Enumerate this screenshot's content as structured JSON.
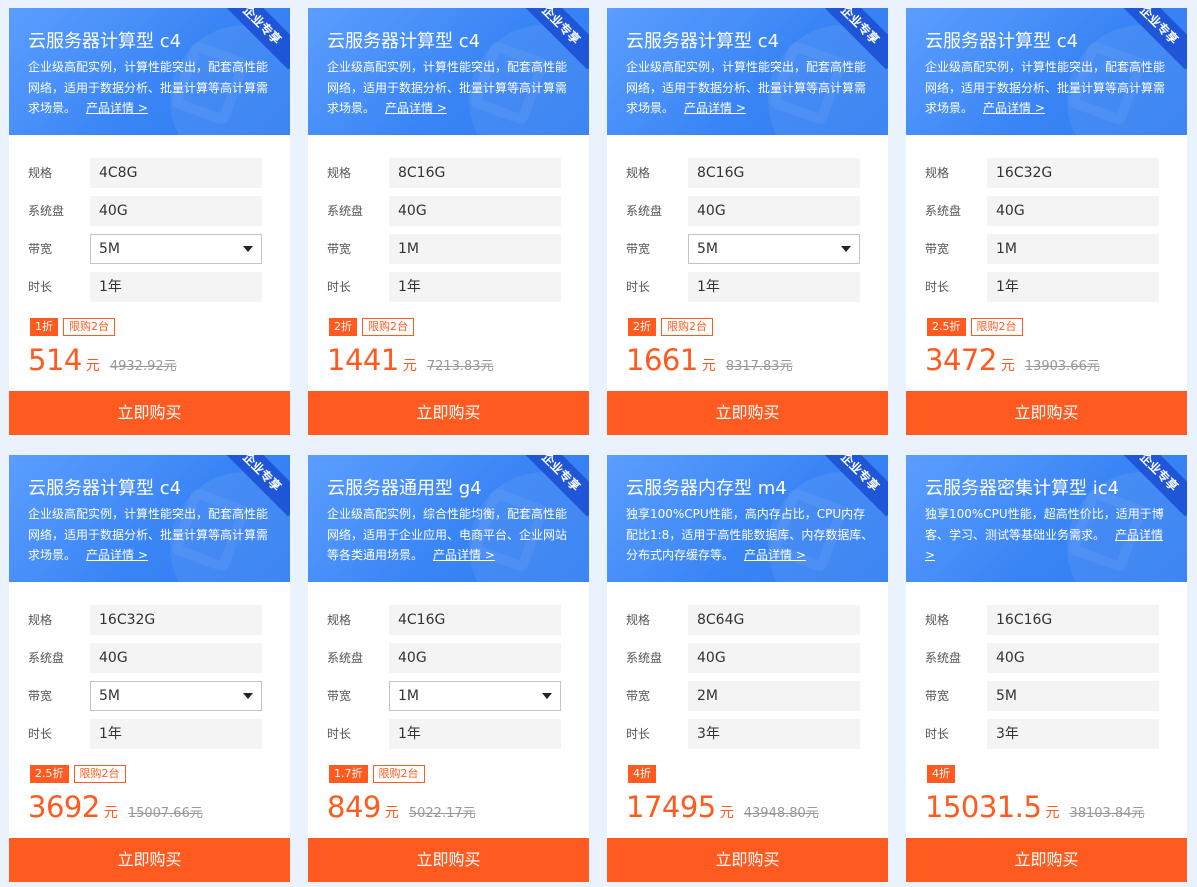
{
  "cards": [
    {
      "ribbon": "企业专享",
      "title": "云服务器计算型 c4",
      "desc": "企业级高配实例，计算性能突出，配套高性能网络，适用于数据分析、批量计算等高计算需求场景。",
      "detail_link": "产品详情 >",
      "specs": [
        {
          "label": "规格",
          "value": "4C8G",
          "select": false
        },
        {
          "label": "系统盘",
          "value": "40G",
          "select": false
        },
        {
          "label": "带宽",
          "value": "5M",
          "select": true
        },
        {
          "label": "时长",
          "value": "1年",
          "select": false
        }
      ],
      "discount": "1折",
      "limit": "限购2台",
      "price": "514",
      "unit": "元",
      "original": "4932.92元",
      "buy": "立即购买"
    },
    {
      "ribbon": "企业专享",
      "title": "云服务器计算型 c4",
      "desc": "企业级高配实例，计算性能突出，配套高性能网络，适用于数据分析、批量计算等高计算需求场景。",
      "detail_link": "产品详情 >",
      "specs": [
        {
          "label": "规格",
          "value": "8C16G",
          "select": false
        },
        {
          "label": "系统盘",
          "value": "40G",
          "select": false
        },
        {
          "label": "带宽",
          "value": "1M",
          "select": false
        },
        {
          "label": "时长",
          "value": "1年",
          "select": false
        }
      ],
      "discount": "2折",
      "limit": "限购2台",
      "price": "1441",
      "unit": "元",
      "original": "7213.83元",
      "buy": "立即购买"
    },
    {
      "ribbon": "企业专享",
      "title": "云服务器计算型 c4",
      "desc": "企业级高配实例，计算性能突出，配套高性能网络，适用于数据分析、批量计算等高计算需求场景。",
      "detail_link": "产品详情 >",
      "specs": [
        {
          "label": "规格",
          "value": "8C16G",
          "select": false
        },
        {
          "label": "系统盘",
          "value": "40G",
          "select": false
        },
        {
          "label": "带宽",
          "value": "5M",
          "select": true
        },
        {
          "label": "时长",
          "value": "1年",
          "select": false
        }
      ],
      "discount": "2折",
      "limit": "限购2台",
      "price": "1661",
      "unit": "元",
      "original": "8317.83元",
      "buy": "立即购买"
    },
    {
      "ribbon": "企业专享",
      "title": "云服务器计算型 c4",
      "desc": "企业级高配实例，计算性能突出，配套高性能网络，适用于数据分析、批量计算等高计算需求场景。",
      "detail_link": "产品详情 >",
      "specs": [
        {
          "label": "规格",
          "value": "16C32G",
          "select": false
        },
        {
          "label": "系统盘",
          "value": "40G",
          "select": false
        },
        {
          "label": "带宽",
          "value": "1M",
          "select": false
        },
        {
          "label": "时长",
          "value": "1年",
          "select": false
        }
      ],
      "discount": "2.5折",
      "limit": "限购2台",
      "price": "3472",
      "unit": "元",
      "original": "13903.66元",
      "buy": "立即购买"
    },
    {
      "ribbon": "企业专享",
      "title": "云服务器计算型 c4",
      "desc": "企业级高配实例，计算性能突出，配套高性能网络，适用于数据分析、批量计算等高计算需求场景。",
      "detail_link": "产品详情 >",
      "specs": [
        {
          "label": "规格",
          "value": "16C32G",
          "select": false
        },
        {
          "label": "系统盘",
          "value": "40G",
          "select": false
        },
        {
          "label": "带宽",
          "value": "5M",
          "select": true
        },
        {
          "label": "时长",
          "value": "1年",
          "select": false
        }
      ],
      "discount": "2.5折",
      "limit": "限购2台",
      "price": "3692",
      "unit": "元",
      "original": "15007.66元",
      "buy": "立即购买"
    },
    {
      "ribbon": "企业专享",
      "title": "云服务器通用型 g4",
      "desc": "企业级高配实例，综合性能均衡，配套高性能网络，适用于企业应用、电商平台、企业网站等各类通用场景。",
      "detail_link": "产品详情 >",
      "specs": [
        {
          "label": "规格",
          "value": "4C16G",
          "select": false
        },
        {
          "label": "系统盘",
          "value": "40G",
          "select": false
        },
        {
          "label": "带宽",
          "value": "1M",
          "select": true
        },
        {
          "label": "时长",
          "value": "1年",
          "select": false
        }
      ],
      "discount": "1.7折",
      "limit": "限购2台",
      "price": "849",
      "unit": "元",
      "original": "5022.17元",
      "buy": "立即购买"
    },
    {
      "ribbon": "企业专享",
      "title": "云服务器内存型 m4",
      "desc": "独享100%CPU性能，高内存占比，CPU内存配比1:8，适用于高性能数据库、内存数据库、分布式内存缓存等。",
      "detail_link": "产品详情 >",
      "specs": [
        {
          "label": "规格",
          "value": "8C64G",
          "select": false
        },
        {
          "label": "系统盘",
          "value": "40G",
          "select": false
        },
        {
          "label": "带宽",
          "value": "2M",
          "select": false
        },
        {
          "label": "时长",
          "value": "3年",
          "select": false
        }
      ],
      "discount": "4折",
      "limit": "",
      "price": "17495",
      "unit": "元",
      "original": "43948.80元",
      "buy": "立即购买"
    },
    {
      "ribbon": "企业专享",
      "title": "云服务器密集计算型 ic4",
      "desc": "独享100%CPU性能，超高性价比，适用于博客、学习、测试等基础业务需求。",
      "detail_link": "产品详情 >",
      "specs": [
        {
          "label": "规格",
          "value": "16C16G",
          "select": false
        },
        {
          "label": "系统盘",
          "value": "40G",
          "select": false
        },
        {
          "label": "带宽",
          "value": "5M",
          "select": false
        },
        {
          "label": "时长",
          "value": "3年",
          "select": false
        }
      ],
      "discount": "4折",
      "limit": "",
      "price": "15031.5",
      "unit": "元",
      "original": "38103.84元",
      "buy": "立即购买"
    }
  ]
}
